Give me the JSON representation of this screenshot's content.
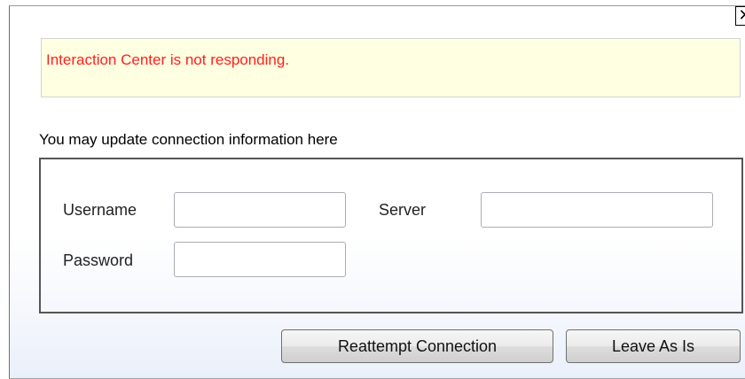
{
  "dialog": {
    "close_glyph": "✕",
    "close_icon": "close-icon"
  },
  "alert": {
    "message": "Interaction Center is not responding.",
    "message_color": "#ff2020",
    "background": "#ffffe1"
  },
  "connection": {
    "caption": "You may update connection information here",
    "username_label": "Username",
    "username_value": "",
    "password_label": "Password",
    "password_value": "",
    "server_label": "Server",
    "server_value": ""
  },
  "buttons": {
    "reattempt_label": "Reattempt Connection",
    "leave_label": "Leave As Is"
  }
}
